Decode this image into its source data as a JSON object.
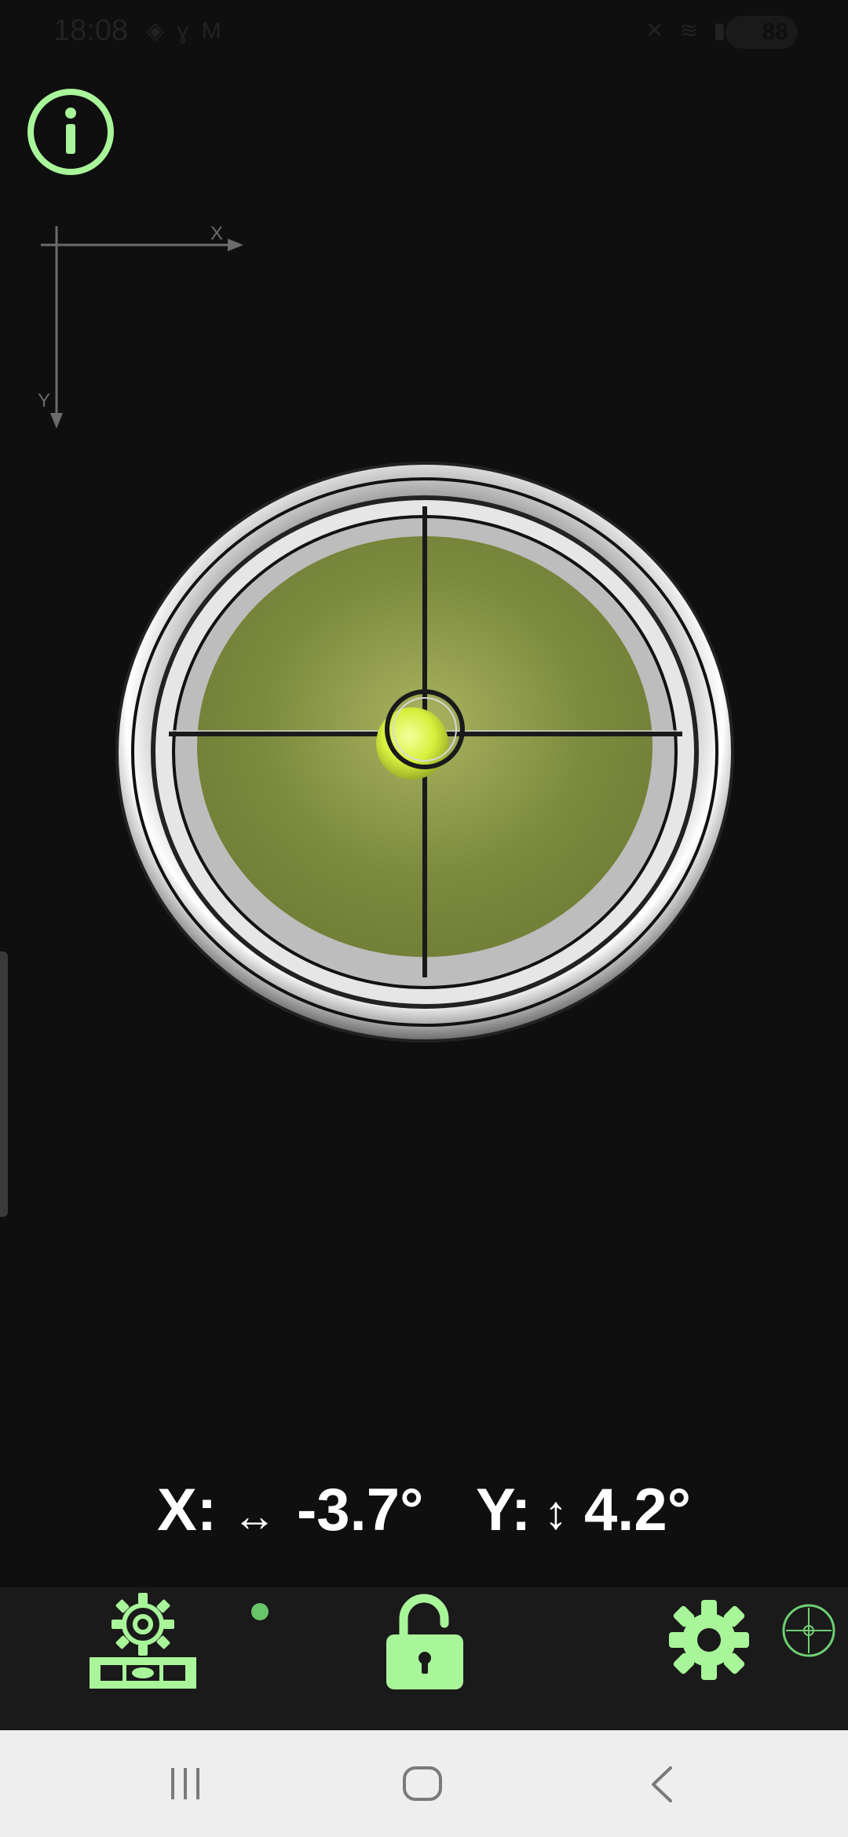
{
  "status_bar": {
    "time": "18:08",
    "left_icons": [
      "navigation-icon",
      "signal-icon",
      "gmail-icon"
    ],
    "right_icons": [
      "mute-icon",
      "wifi-icon",
      "cell-signal-icon"
    ],
    "battery": "88"
  },
  "axis_indicator": {
    "x_label": "X",
    "y_label": "Y"
  },
  "level": {
    "bubble_color": "#d7f03d",
    "liquid_color": "#7b8a3e"
  },
  "readout": {
    "x_label": "X:",
    "x_arrow": "↔",
    "x_value": "-3.7°",
    "y_label": "Y:",
    "y_arrow": "↕",
    "y_value": "4.2°"
  },
  "toolbar": {
    "left_icon": "calibrate-level-icon",
    "lock_icon": "unlock-icon",
    "settings_icon": "gear-icon",
    "crosshair_icon": "crosshair-icon",
    "accent_color": "#a9f59a"
  },
  "nav_bar": {
    "recents_icon": "recents-icon",
    "home_icon": "home-icon",
    "back_icon": "back-icon"
  }
}
